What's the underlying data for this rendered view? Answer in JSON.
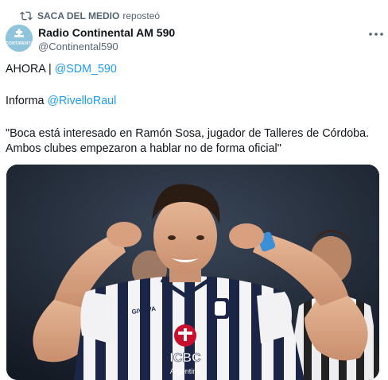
{
  "repost": {
    "icon": "repost-icon",
    "account": "SACA DEL MEDIO",
    "verb": "reposteó"
  },
  "author": {
    "name": "Radio Continental AM 590",
    "handle": "@Continental590",
    "avatar_text": "CONTINENTAL"
  },
  "tweet": {
    "line1_prefix": "AHORA | ",
    "line1_mention": "@SDM_590",
    "line2_prefix": "Informa ",
    "line2_mention": "@RivelloRaul",
    "line3": "\"Boca está interesado en Ramón Sosa, jugador de Talleres de Córdoba.",
    "line4": "Ambos clubes empezaron a hablar no de forma oficial\""
  },
  "media": {
    "kind": "photo",
    "subject": "player-photo",
    "shirt_sponsor": "ICBC",
    "shirt_sponsor_sub": "Argentina",
    "brand": "GIVOVA"
  },
  "colors": {
    "link": "#1d9bf0",
    "secondary": "#536471",
    "text": "#0f1419"
  }
}
